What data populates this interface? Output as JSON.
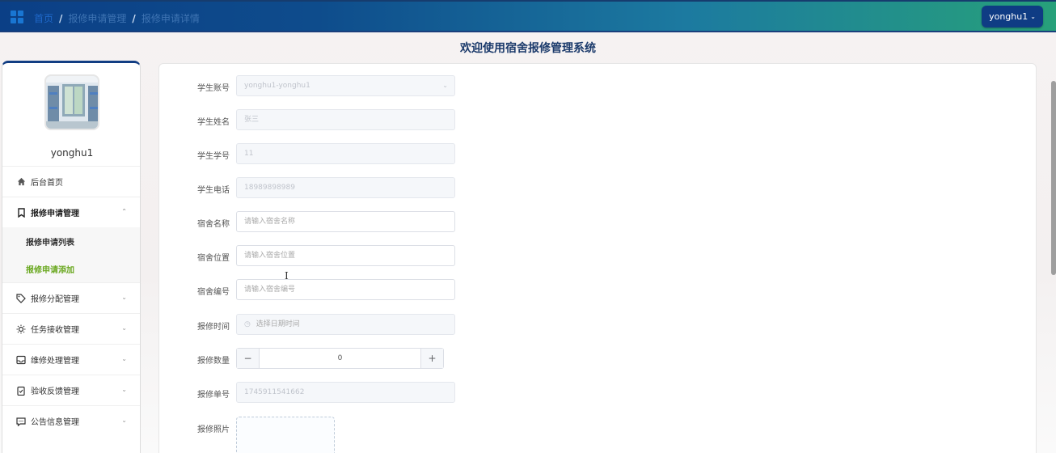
{
  "breadcrumb": {
    "home": "首页",
    "level1": "报修申请管理",
    "level2": "报修申请详情"
  },
  "header": {
    "user_label": "yonghu1"
  },
  "page_title": "欢迎使用宿舍报修管理系统",
  "sidebar": {
    "username": "yonghu1",
    "items": [
      {
        "label": "后台首页"
      },
      {
        "label": "报修申请管理"
      },
      {
        "label": "报修分配管理"
      },
      {
        "label": "任务接收管理"
      },
      {
        "label": "维修处理管理"
      },
      {
        "label": "验收反馈管理"
      },
      {
        "label": "公告信息管理"
      }
    ],
    "subitems": [
      {
        "label": "报修申请列表"
      },
      {
        "label": "报修申请添加"
      }
    ]
  },
  "form": {
    "account_label": "学生账号",
    "account_value": "yonghu1-yonghu1",
    "name_label": "学生姓名",
    "name_value": "张三",
    "number_label": "学生学号",
    "number_value": "11",
    "phone_label": "学生电话",
    "phone_value": "18989898989",
    "dorm_name_label": "宿舍名称",
    "dorm_name_placeholder": "请输入宿舍名称",
    "dorm_location_label": "宿舍位置",
    "dorm_location_placeholder": "请输入宿舍位置",
    "dorm_code_label": "宿舍编号",
    "dorm_code_placeholder": "请输入宿舍编号",
    "time_label": "报修时间",
    "time_placeholder": "选择日期时间",
    "qty_label": "报修数量",
    "qty_value": "0",
    "qty_minus": "−",
    "qty_plus": "+",
    "order_label": "报修单号",
    "order_value": "1745911541662",
    "photo_label": "报修照片"
  },
  "colors": {
    "accent": "#0f3c84",
    "active_sub": "#6aa820"
  }
}
